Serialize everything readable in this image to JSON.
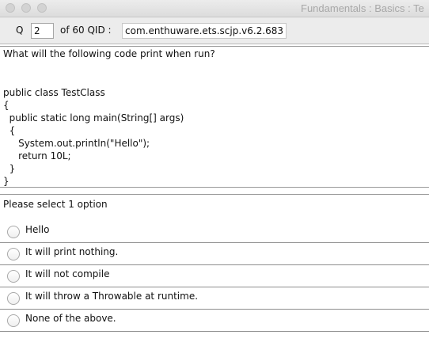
{
  "window": {
    "title": "Fundamentals : Basics  :  Te"
  },
  "question_bar": {
    "q_label": "Q",
    "question_number": "2",
    "of_text": "of 60 QID :",
    "qid": "com.enthuware.ets.scjp.v6.2.683"
  },
  "question": {
    "prompt": "What will the following code print when run?",
    "code_lines": [
      "public class TestClass",
      "{",
      "  public static long main(String[] args)",
      "  {",
      "     System.out.println(\"Hello\");",
      "     return 10L;",
      "  }",
      "}"
    ]
  },
  "options": {
    "hint": "Please select 1 option",
    "items": [
      {
        "label": "Hello",
        "selected": false
      },
      {
        "label": "It will print nothing.",
        "selected": false
      },
      {
        "label": "It will not compile",
        "selected": false
      },
      {
        "label": "It will throw a Throwable at runtime.",
        "selected": false
      },
      {
        "label": "None of the above.",
        "selected": false
      }
    ]
  }
}
